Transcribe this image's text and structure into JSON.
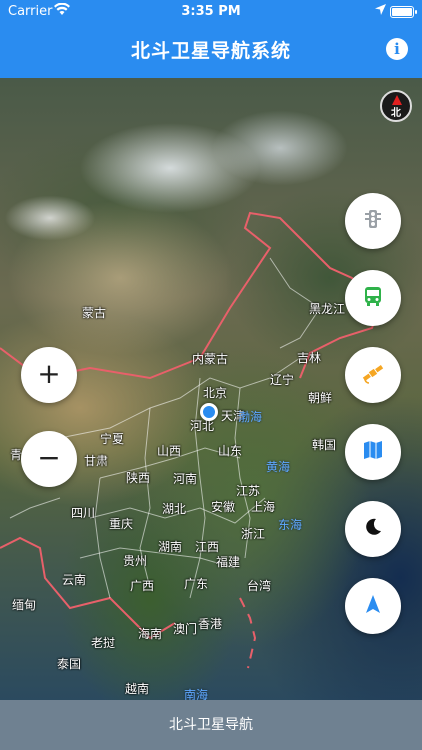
{
  "status_bar": {
    "carrier": "Carrier",
    "time": "3:35 PM"
  },
  "nav": {
    "title": "北斗卫星导航系统",
    "info_label": "i"
  },
  "map": {
    "compass_label": "北",
    "labels": [
      {
        "text": "蒙古"
      },
      {
        "text": "黑龙江"
      },
      {
        "text": "内蒙古"
      },
      {
        "text": "吉林"
      },
      {
        "text": "北京"
      },
      {
        "text": "辽宁"
      },
      {
        "text": "朝鲜"
      },
      {
        "text": "河北"
      },
      {
        "text": "天津"
      },
      {
        "text": "宁夏"
      },
      {
        "text": "山西"
      },
      {
        "text": "山东"
      },
      {
        "text": "韩国"
      },
      {
        "text": "青"
      },
      {
        "text": "甘肃"
      },
      {
        "text": "陕西"
      },
      {
        "text": "河南"
      },
      {
        "text": "江苏"
      },
      {
        "text": "四川"
      },
      {
        "text": "湖北"
      },
      {
        "text": "安徽"
      },
      {
        "text": "上海"
      },
      {
        "text": "重庆"
      },
      {
        "text": "浙江"
      },
      {
        "text": "湖南"
      },
      {
        "text": "江西"
      },
      {
        "text": "贵州"
      },
      {
        "text": "福建"
      },
      {
        "text": "云南"
      },
      {
        "text": "广西"
      },
      {
        "text": "广东"
      },
      {
        "text": "台湾"
      },
      {
        "text": "缅甸"
      },
      {
        "text": "澳门"
      },
      {
        "text": "香港"
      },
      {
        "text": "老挝"
      },
      {
        "text": "海南"
      },
      {
        "text": "泰国"
      },
      {
        "text": "越南"
      }
    ],
    "sea_labels": [
      {
        "text": "渤海"
      },
      {
        "text": "黄海"
      },
      {
        "text": "东海"
      },
      {
        "text": "南海"
      }
    ]
  },
  "controls": {
    "zoom_in": "+",
    "zoom_out": "−",
    "buttons": [
      {
        "name": "traffic",
        "icon": "traffic-light-icon",
        "color": "#9aa0a6"
      },
      {
        "name": "bus",
        "icon": "bus-icon",
        "color": "#2fb24a"
      },
      {
        "name": "satellite",
        "icon": "satellite-icon",
        "color": "#f5a623"
      },
      {
        "name": "map",
        "icon": "map-icon",
        "color": "#2a8cf0"
      },
      {
        "name": "night",
        "icon": "moon-icon",
        "color": "#111111"
      },
      {
        "name": "locate",
        "icon": "navigation-arrow-icon",
        "color": "#2a8cf0"
      }
    ]
  },
  "bottom_bar": {
    "label": "北斗卫星导航"
  },
  "colors": {
    "primary": "#2a8cf0",
    "bottom_bar": "#6f8191",
    "border_red": "#e8606a"
  }
}
